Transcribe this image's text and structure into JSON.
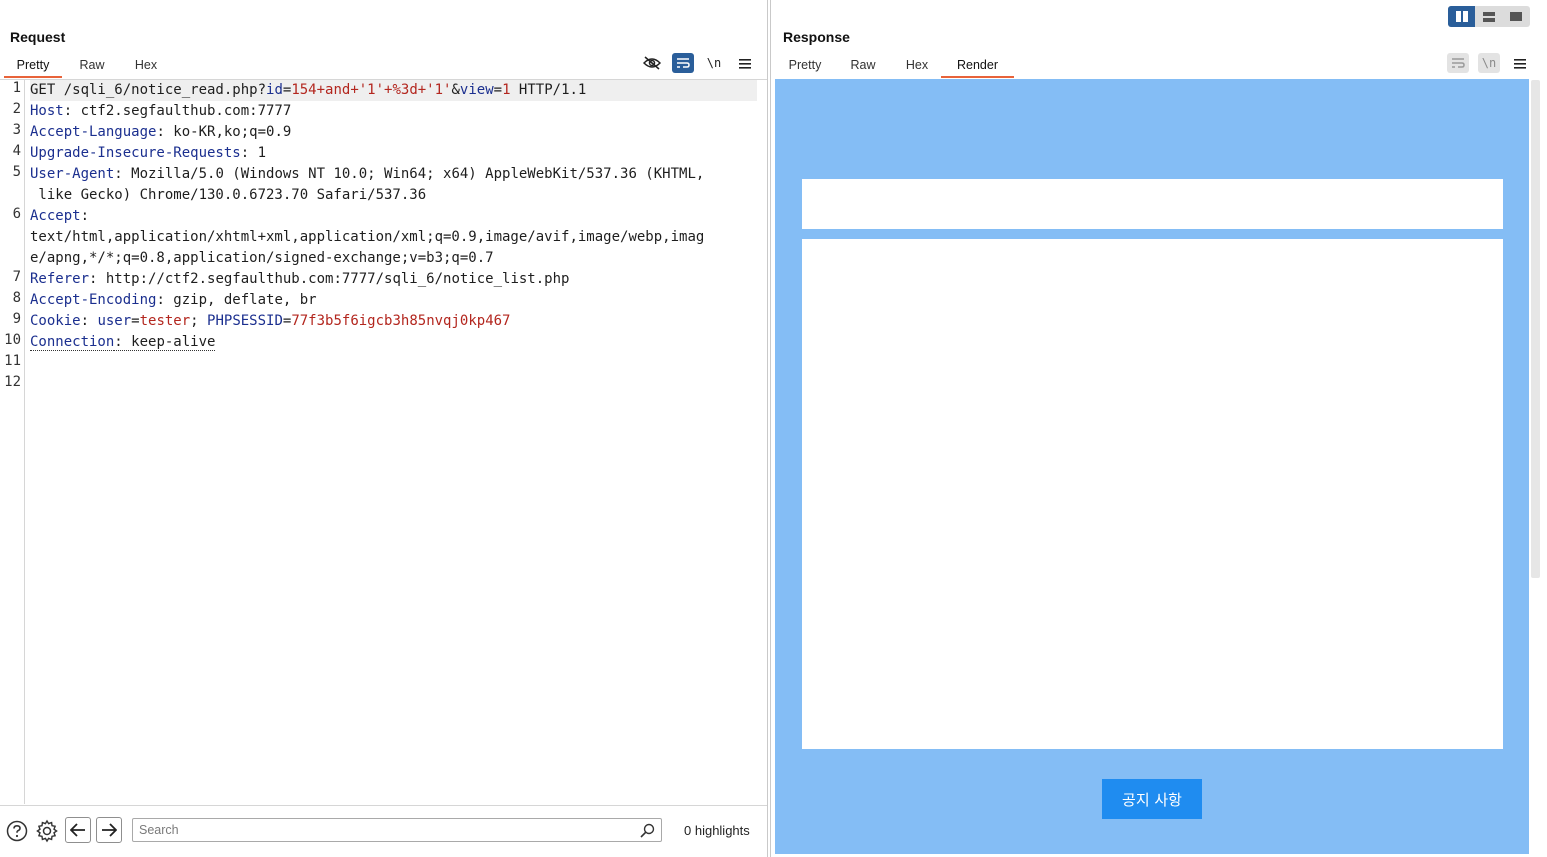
{
  "layout_toggles": [
    "split-horizontal-icon",
    "split-vertical-icon",
    "single-pane-icon"
  ],
  "request": {
    "title": "Request",
    "tabs": [
      "Pretty",
      "Raw",
      "Hex"
    ],
    "active_tab": "Pretty",
    "tools": {
      "newline": "\\n"
    },
    "lines": [
      {
        "num": "1"
      },
      {
        "num": "2"
      },
      {
        "num": "3"
      },
      {
        "num": "4"
      },
      {
        "num": "5"
      },
      {
        "num": "6"
      },
      {
        "num": "7"
      },
      {
        "num": "8"
      },
      {
        "num": "9"
      },
      {
        "num": "10"
      },
      {
        "num": "11"
      },
      {
        "num": "12"
      }
    ],
    "code": {
      "l1": {
        "method": "GET /sqli_6/notice_read.php?",
        "p1": "id",
        "eq1": "=",
        "v1": "154+and+'1'+%3d+'1'",
        "amp": "&",
        "p2": "view",
        "eq2": "=",
        "v2": "1",
        "tail": " HTTP/1.1"
      },
      "l2": {
        "name": "Host",
        "value": ": ctf2.segfaulthub.com:7777"
      },
      "l3": {
        "name": "Accept-Language",
        "value": ": ko-KR,ko;q=0.9"
      },
      "l4": {
        "name": "Upgrade-Insecure-Requests",
        "value": ": 1"
      },
      "l5": {
        "name": "User-Agent",
        "value": ": Mozilla/5.0 (Windows NT 10.0; Win64; x64) AppleWebKit/537.36 (KHTML,",
        "cont": " like Gecko) Chrome/130.0.6723.70 Safari/537.36"
      },
      "l6": {
        "name": "Accept",
        "value": ":",
        "cont1": "text/html,application/xhtml+xml,application/xml;q=0.9,image/avif,image/webp,imag",
        "cont2": "e/apng,*/*;q=0.8,application/signed-exchange;v=b3;q=0.7"
      },
      "l7": {
        "name": "Referer",
        "value": ": http://ctf2.segfaulthub.com:7777/sqli_6/notice_list.php"
      },
      "l8": {
        "name": "Accept-Encoding",
        "value": ": gzip, deflate, br"
      },
      "l9": {
        "name": "Cookie",
        "sep": ": ",
        "c1": "user",
        "eq": "=",
        "c1v": "tester",
        "semi": "; ",
        "c2": "PHPSESSID",
        "c2v": "77f3b5f6igcb3h85nvqj0kp467"
      },
      "l10": {
        "name": "Connection",
        "value": ": keep-alive"
      }
    },
    "search": {
      "placeholder": "Search",
      "highlights": "0 highlights"
    }
  },
  "response": {
    "title": "Response",
    "tabs": [
      "Pretty",
      "Raw",
      "Hex",
      "Render"
    ],
    "active_tab": "Render",
    "tools": {
      "newline": "\\n"
    },
    "render": {
      "button_label": "공지 사항",
      "background": "#84bdf5",
      "button_color": "#1f8cf0"
    }
  },
  "colors": {
    "accent": "#e8633a",
    "toggle_active": "#2a5e9a"
  }
}
